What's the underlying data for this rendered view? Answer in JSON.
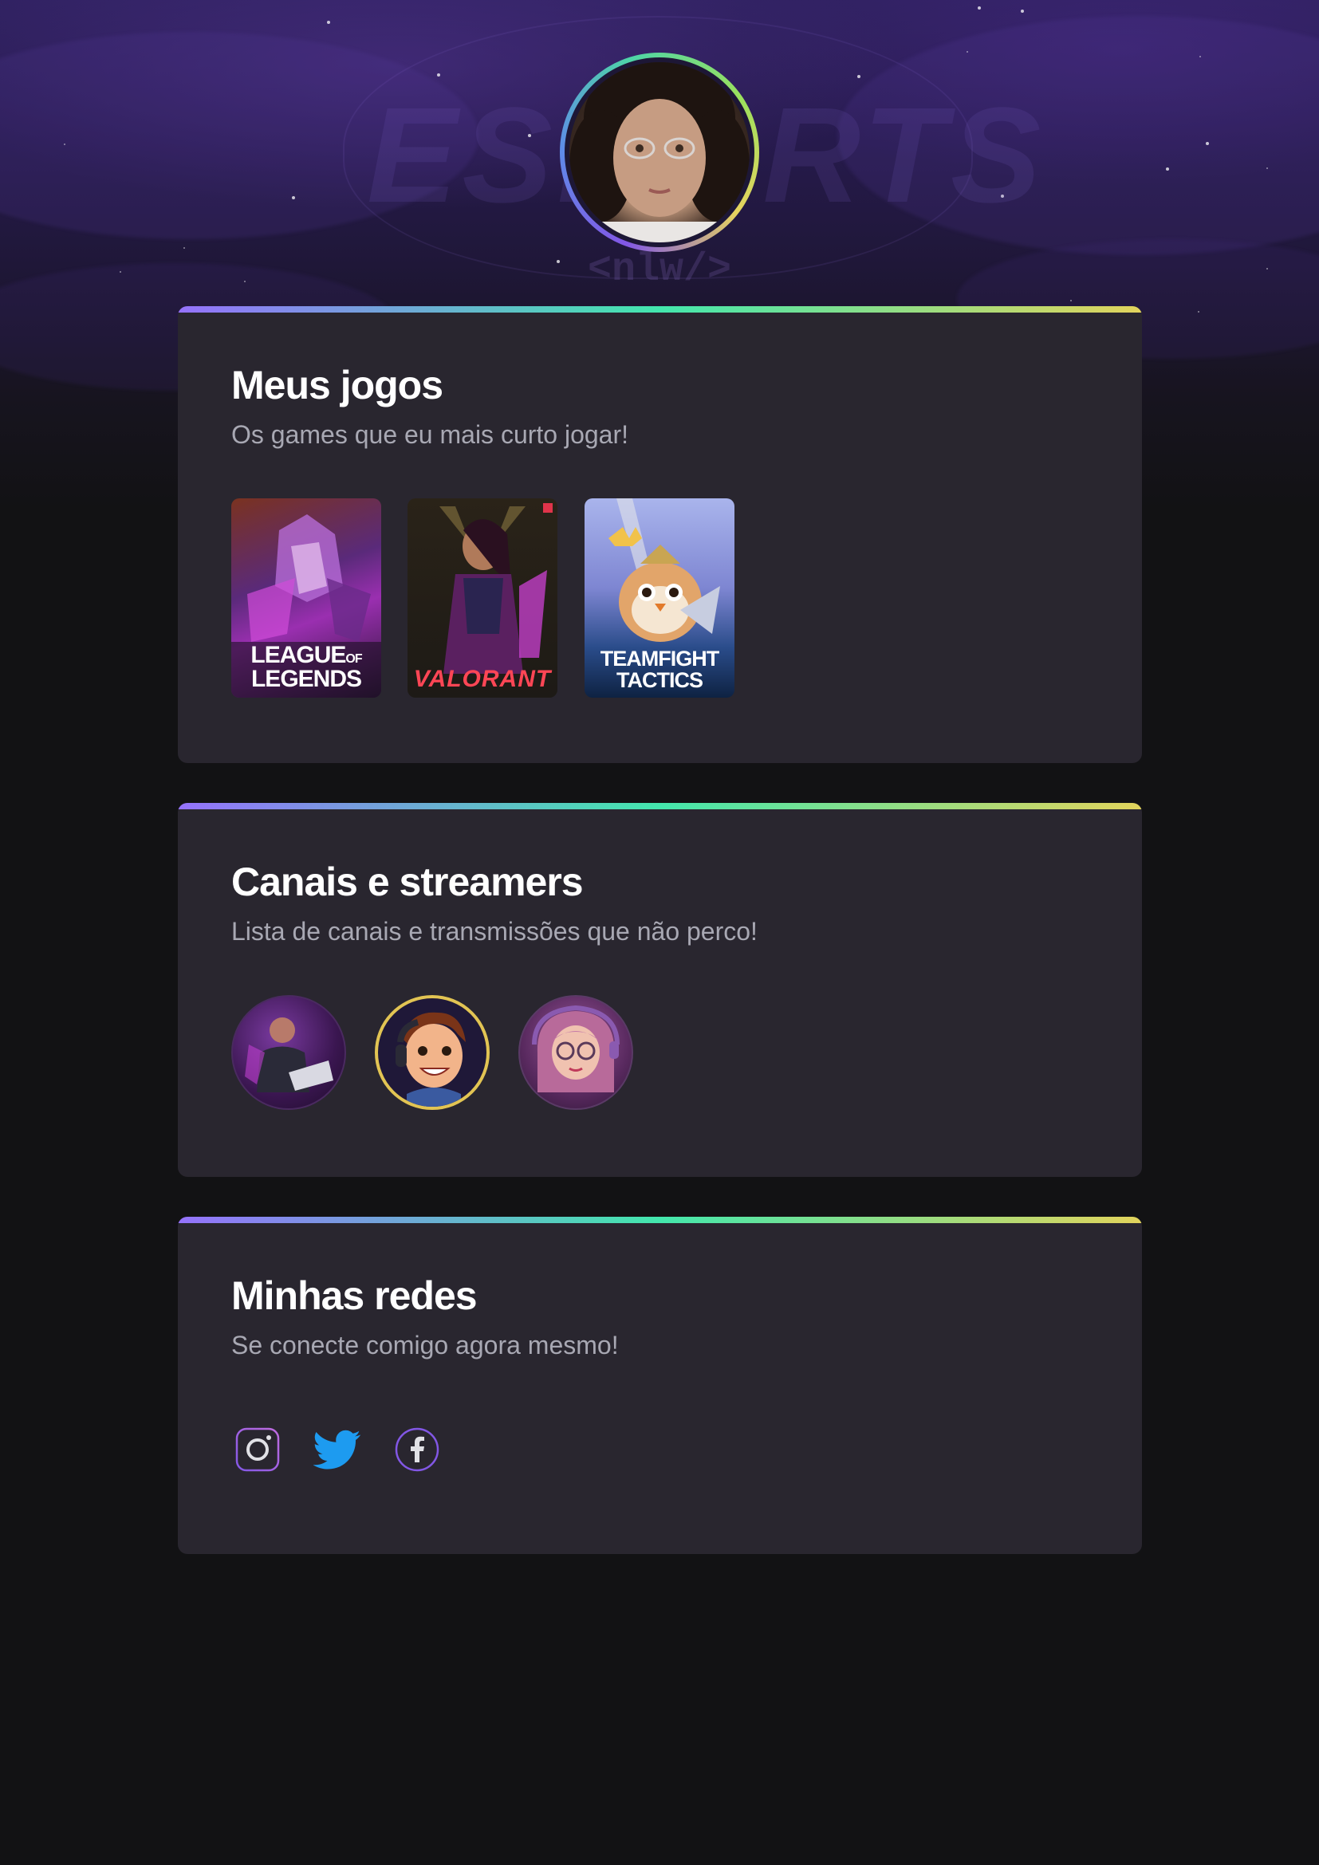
{
  "hero": {
    "wordmark": "ESPORTS",
    "tag": "<nlw/>",
    "avatar_icon": "profile-photo"
  },
  "games_card": {
    "title": "Meus jogos",
    "subtitle": "Os games que eu mais curto jogar!",
    "games": [
      {
        "name": "League of Legends",
        "label_line1": "LEAGUE",
        "label_of": "OF",
        "label_line2": "LEGENDS"
      },
      {
        "name": "Valorant",
        "label_line1": "VALORANT"
      },
      {
        "name": "Teamfight Tactics",
        "label_line1": "TEAMFIGHT",
        "label_line2": "TACTICS"
      }
    ]
  },
  "streamers_card": {
    "title": "Canais e streamers",
    "subtitle": "Lista de canais e transmissões que não perco!",
    "streamers": [
      {
        "icon": "streamer-avatar-1"
      },
      {
        "icon": "streamer-avatar-2"
      },
      {
        "icon": "streamer-avatar-3"
      }
    ]
  },
  "social_card": {
    "title": "Minhas redes",
    "subtitle": "Se conecte comigo agora mesmo!",
    "links": [
      {
        "icon": "instagram-icon",
        "color": "#8257e5"
      },
      {
        "icon": "twitter-icon",
        "color": "#1d9bf0"
      },
      {
        "icon": "facebook-icon",
        "color": "#8257e5"
      }
    ]
  },
  "colors": {
    "background": "#121214",
    "card": "#29262f",
    "gradient_start": "#9572fc",
    "gradient_mid": "#43e7ad",
    "gradient_end": "#e2d45c",
    "text": "#ffffff",
    "muted": "#a8a8b3"
  }
}
